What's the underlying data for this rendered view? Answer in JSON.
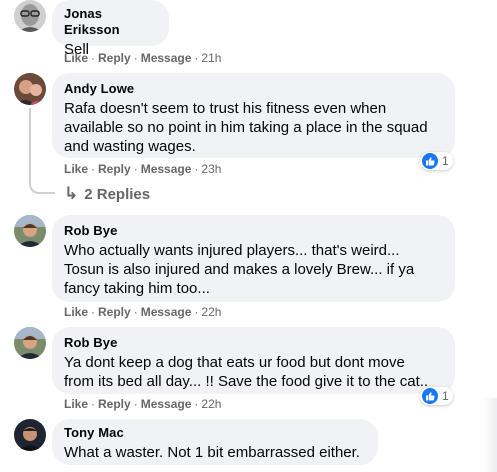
{
  "comments": [
    {
      "author": "Jonas Eriksson",
      "text": "Sell",
      "actions": {
        "like": "Like",
        "reply": "Reply",
        "message": "Message",
        "time": "21h"
      },
      "avatar": "avatar-grayscale-glasses"
    },
    {
      "author": "Andy Lowe",
      "lines": [
        "Rafa doesn't seem to trust his fitness even when",
        "available so no point in him taking a place in the squad",
        "and wasting wages."
      ],
      "actions": {
        "like": "Like",
        "reply": "Reply",
        "message": "Message",
        "time": "23h"
      },
      "reaction": {
        "icon": "thumbs-up-icon",
        "count": "1"
      },
      "replies_label": "2 Replies",
      "avatar": "avatar-two-people"
    },
    {
      "author": "Rob Bye",
      "lines": [
        "Who actually wants injured players... that's weird...",
        "Tosun is also injured and makes a lovely Brew... if ya",
        "fancy taking him too..."
      ],
      "actions": {
        "like": "Like",
        "reply": "Reply",
        "message": "Message",
        "time": "22h"
      },
      "avatar": "avatar-man-outdoors"
    },
    {
      "author": "Rob Bye",
      "lines": [
        "Ya dont keep a dog that eats ur food but dont move",
        "from its bed all day... !! Save the food give it to the cat.."
      ],
      "actions": {
        "like": "Like",
        "reply": "Reply",
        "message": "Message",
        "time": "22h"
      },
      "reaction": {
        "icon": "thumbs-up-icon",
        "count": "1"
      },
      "avatar": "avatar-man-outdoors"
    },
    {
      "author": "Tony Mac",
      "text": "What a waster. Not 1 bit embarrassed either.",
      "avatar": "avatar-man-dark"
    }
  ],
  "colors": {
    "bubble": "#f0f2f5",
    "secondary_text": "#65676b",
    "like_blue": "#1877f2",
    "thread_line": "#ced0d4"
  }
}
